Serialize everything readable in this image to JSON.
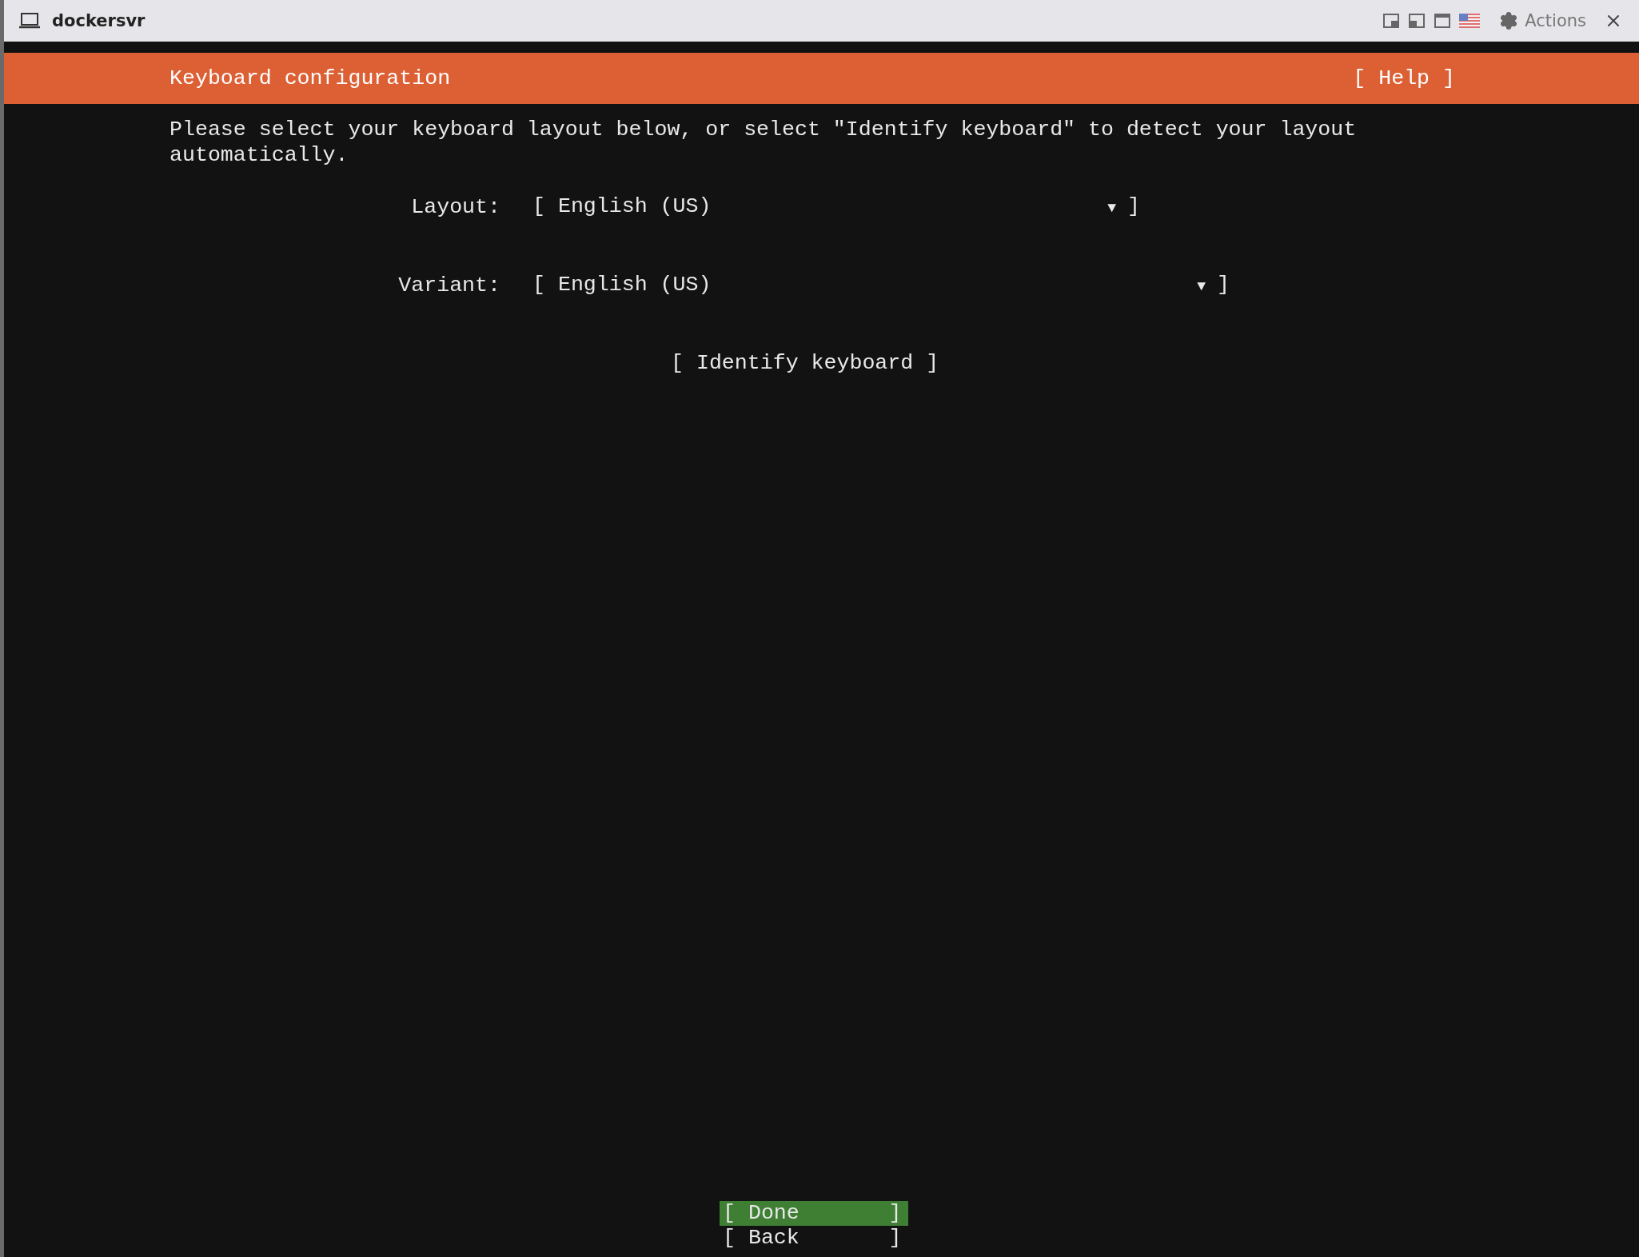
{
  "window": {
    "title": "dockersvr",
    "actions": "Actions"
  },
  "header": {
    "title": "Keyboard configuration",
    "help": "[ Help ]"
  },
  "intro": "Please select your keyboard layout below, or select \"Identify keyboard\" to detect your layout automatically.",
  "fields": [
    {
      "label": "Layout:",
      "open": "[",
      "value": "English (US)",
      "arrow": "▼",
      "close": "]"
    },
    {
      "label": "Variant:",
      "open": "[",
      "value": "English (US)",
      "arrow": "▼",
      "close": "]"
    }
  ],
  "identify": "[ Identify keyboard ]",
  "buttons": [
    {
      "label": "[ Done       ]",
      "selected": true
    },
    {
      "label": "[ Back       ]",
      "selected": false
    }
  ]
}
